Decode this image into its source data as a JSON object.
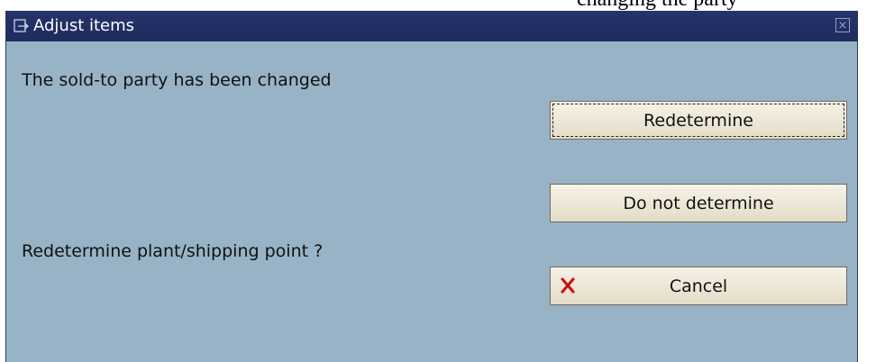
{
  "background_caption": "changing the party",
  "dialog": {
    "title": "Adjust items",
    "close_icon": "close-icon",
    "message_line1": "The sold-to party has been changed",
    "message_line2": "Redetermine plant/shipping point ?",
    "buttons": {
      "redetermine": "Redetermine",
      "do_not_determine": "Do not determine",
      "cancel": "Cancel"
    }
  },
  "colors": {
    "titlebar": "#1f2b5e",
    "dialog_bg": "#98b3c6",
    "button_bg": "#ece6d5",
    "cancel_icon": "#d91a1a"
  }
}
